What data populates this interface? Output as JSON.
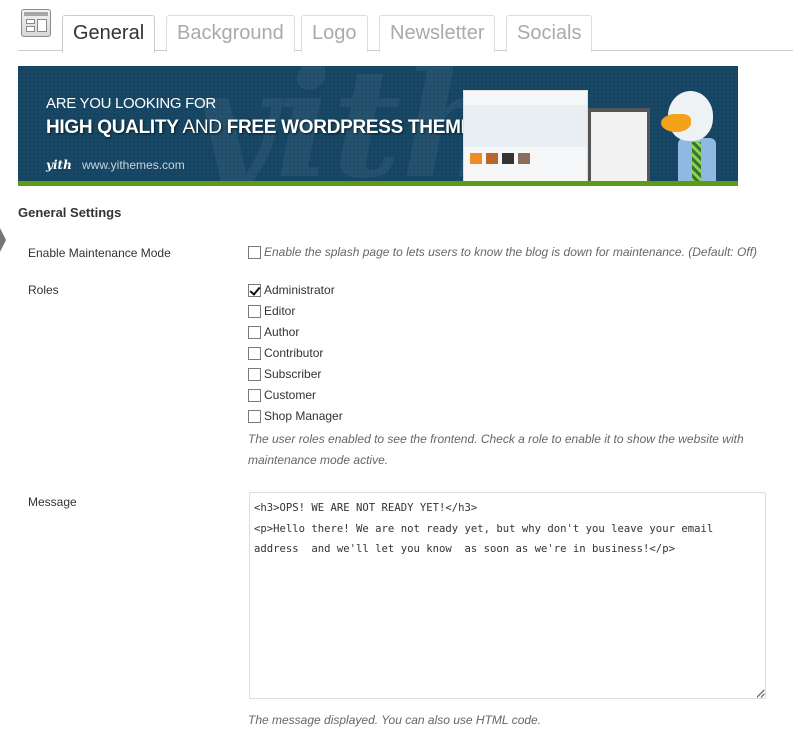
{
  "tabs": [
    {
      "label": "General",
      "active": true
    },
    {
      "label": "Background",
      "active": false
    },
    {
      "label": "Logo",
      "active": false
    },
    {
      "label": "Newsletter",
      "active": false
    },
    {
      "label": "Socials",
      "active": false
    }
  ],
  "banner": {
    "line1": "ARE YOU LOOKING FOR",
    "line2_bold1": "HIGH QUALITY",
    "line2_mid": " AND ",
    "line2_bold2": "FREE WORDPRESS THEMES?",
    "logo": "yith",
    "url": "www.yithemes.com",
    "watermark": "yith",
    "colors": {
      "background": "#154562",
      "accent_stripe": "#5c9b16"
    }
  },
  "section_title": "General Settings",
  "maintenance": {
    "label": "Enable Maintenance Mode",
    "checked": false,
    "description": "Enable the splash page to lets users to know the blog is down for maintenance. (Default: Off)"
  },
  "roles": {
    "label": "Roles",
    "items": [
      {
        "label": "Administrator",
        "checked": true
      },
      {
        "label": "Editor",
        "checked": false
      },
      {
        "label": "Author",
        "checked": false
      },
      {
        "label": "Contributor",
        "checked": false
      },
      {
        "label": "Subscriber",
        "checked": false
      },
      {
        "label": "Customer",
        "checked": false
      },
      {
        "label": "Shop Manager",
        "checked": false
      }
    ],
    "help": "The user roles enabled to see the frontend. Check a role to enable it to show the website with maintenance mode active."
  },
  "message": {
    "label": "Message",
    "value": "<h3>OPS! WE ARE NOT READY YET!</h3>\n<p>Hello there! We are not ready yet, but why don't you leave your email address  and we'll let you know  as soon as we're in business!</p>",
    "help": "The message displayed. You can also use HTML code."
  }
}
